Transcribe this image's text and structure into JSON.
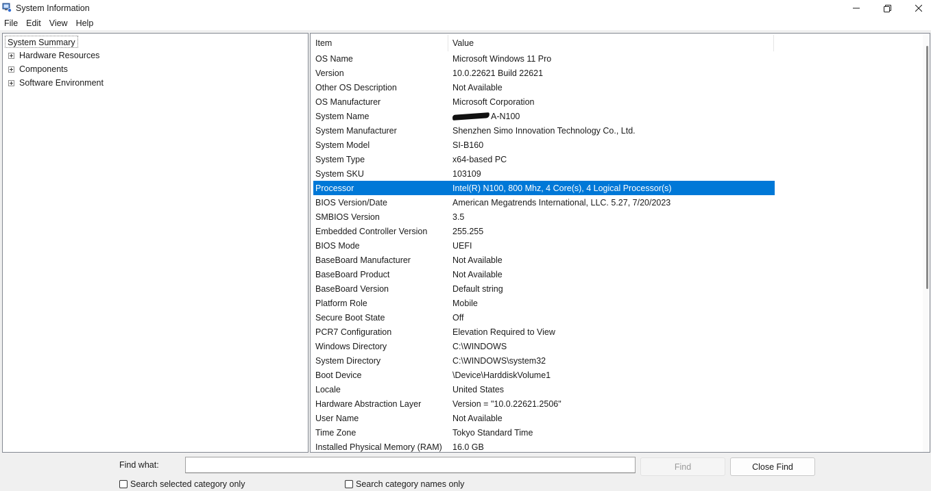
{
  "window": {
    "title": "System Information",
    "icon": "system-information-icon"
  },
  "menu": [
    "File",
    "Edit",
    "View",
    "Help"
  ],
  "tree": {
    "root": "System Summary",
    "nodes": [
      "Hardware Resources",
      "Components",
      "Software Environment"
    ]
  },
  "table": {
    "headers": {
      "item": "Item",
      "value": "Value"
    },
    "selected_row": 9,
    "rows": [
      {
        "item": "OS Name",
        "value": "Microsoft Windows 11 Pro"
      },
      {
        "item": "Version",
        "value": "10.0.22621 Build 22621"
      },
      {
        "item": "Other OS Description",
        "value": "Not Available"
      },
      {
        "item": "OS Manufacturer",
        "value": "Microsoft Corporation"
      },
      {
        "item": "System Name",
        "value": "A-N100"
      },
      {
        "item": "System Manufacturer",
        "value": "Shenzhen Simo Innovation Technology Co., Ltd."
      },
      {
        "item": "System Model",
        "value": "SI-B160"
      },
      {
        "item": "System Type",
        "value": "x64-based PC"
      },
      {
        "item": "System SKU",
        "value": "103109"
      },
      {
        "item": "Processor",
        "value": "Intel(R) N100, 800 Mhz, 4 Core(s), 4 Logical Processor(s)"
      },
      {
        "item": "BIOS Version/Date",
        "value": "American Megatrends International, LLC. 5.27, 7/20/2023"
      },
      {
        "item": "SMBIOS Version",
        "value": "3.5"
      },
      {
        "item": "Embedded Controller Version",
        "value": "255.255"
      },
      {
        "item": "BIOS Mode",
        "value": "UEFI"
      },
      {
        "item": "BaseBoard Manufacturer",
        "value": "Not Available"
      },
      {
        "item": "BaseBoard Product",
        "value": "Not Available"
      },
      {
        "item": "BaseBoard Version",
        "value": "Default string"
      },
      {
        "item": "Platform Role",
        "value": "Mobile"
      },
      {
        "item": "Secure Boot State",
        "value": "Off"
      },
      {
        "item": "PCR7 Configuration",
        "value": "Elevation Required to View"
      },
      {
        "item": "Windows Directory",
        "value": "C:\\WINDOWS"
      },
      {
        "item": "System Directory",
        "value": "C:\\WINDOWS\\system32"
      },
      {
        "item": "Boot Device",
        "value": "\\Device\\HarddiskVolume1"
      },
      {
        "item": "Locale",
        "value": "United States"
      },
      {
        "item": "Hardware Abstraction Layer",
        "value": "Version = \"10.0.22621.2506\""
      },
      {
        "item": "User Name",
        "value": "Not Available"
      },
      {
        "item": "Time Zone",
        "value": "Tokyo Standard Time"
      },
      {
        "item": "Installed Physical Memory (RAM)",
        "value": "16.0 GB"
      }
    ]
  },
  "find": {
    "label": "Find what:",
    "value": "",
    "find_button": "Find",
    "close_button": "Close Find",
    "check_selected_label": "Search selected category only",
    "check_names_label": "Search category names only"
  },
  "colors": {
    "selection": "#0078d7"
  }
}
